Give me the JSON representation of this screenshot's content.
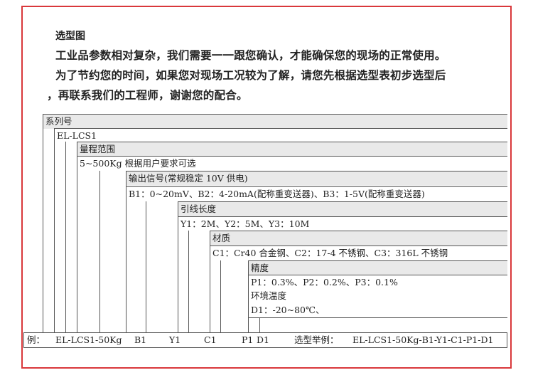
{
  "header": {
    "title": "选型图",
    "intro_lines": [
      "工业品参数相对复杂，我们需要一一跟您确认，才能确保您的现场的正常使用。",
      "为了节约您的时间，如果您对现场工况较为了解，请您先根据选型表初步选型后",
      "，再联系我们的工程师，谢谢您的配合。"
    ]
  },
  "diagram": {
    "series": {
      "label": "系列号",
      "value": "EL-LCS1"
    },
    "range": {
      "label": "量程范围",
      "value": "5~500Kg 根据用户要求可选"
    },
    "signal": {
      "label": "输出信号(常规稳定 10V 供电)",
      "value": "B1：0~20mV、B2：4-20mA(配称重变送器)、B3：1-5V(配称重变送器)"
    },
    "cable": {
      "label": "引线长度",
      "value": "Y1：2M、Y2：5M、Y3：10M"
    },
    "material": {
      "label": "材质",
      "value": "C1：Cr40 合金钢、C2：17-4 不锈钢、C3：316L 不锈钢"
    },
    "accuracy": {
      "label": "精度",
      "value": "P1：0.3%、P2：0.2%、P3：0.1%"
    },
    "temperature": {
      "label": "环境温度",
      "value": "D1：-20~80℃、"
    }
  },
  "example": {
    "prefix": "例：",
    "model": "EL-LCS1-50Kg",
    "b": "B1",
    "y": "Y1",
    "c": "C1",
    "p": "P1",
    "d": "D1",
    "selection_label": "选型举例：",
    "selection_value": "EL-LCS1-50Kg-B1-Y1-C1-P1-D1"
  }
}
